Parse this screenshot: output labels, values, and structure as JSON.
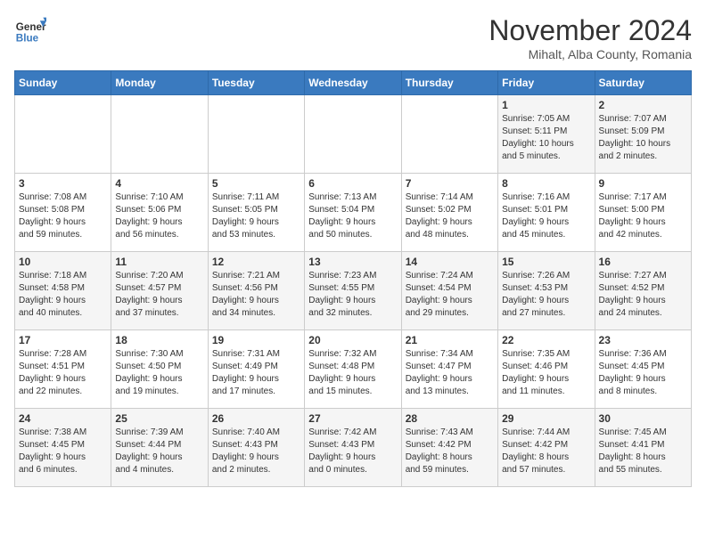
{
  "logo": {
    "general": "General",
    "blue": "Blue"
  },
  "header": {
    "month": "November 2024",
    "location": "Mihalt, Alba County, Romania"
  },
  "weekdays": [
    "Sunday",
    "Monday",
    "Tuesday",
    "Wednesday",
    "Thursday",
    "Friday",
    "Saturday"
  ],
  "weeks": [
    [
      {
        "day": "",
        "info": ""
      },
      {
        "day": "",
        "info": ""
      },
      {
        "day": "",
        "info": ""
      },
      {
        "day": "",
        "info": ""
      },
      {
        "day": "",
        "info": ""
      },
      {
        "day": "1",
        "info": "Sunrise: 7:05 AM\nSunset: 5:11 PM\nDaylight: 10 hours\nand 5 minutes."
      },
      {
        "day": "2",
        "info": "Sunrise: 7:07 AM\nSunset: 5:09 PM\nDaylight: 10 hours\nand 2 minutes."
      }
    ],
    [
      {
        "day": "3",
        "info": "Sunrise: 7:08 AM\nSunset: 5:08 PM\nDaylight: 9 hours\nand 59 minutes."
      },
      {
        "day": "4",
        "info": "Sunrise: 7:10 AM\nSunset: 5:06 PM\nDaylight: 9 hours\nand 56 minutes."
      },
      {
        "day": "5",
        "info": "Sunrise: 7:11 AM\nSunset: 5:05 PM\nDaylight: 9 hours\nand 53 minutes."
      },
      {
        "day": "6",
        "info": "Sunrise: 7:13 AM\nSunset: 5:04 PM\nDaylight: 9 hours\nand 50 minutes."
      },
      {
        "day": "7",
        "info": "Sunrise: 7:14 AM\nSunset: 5:02 PM\nDaylight: 9 hours\nand 48 minutes."
      },
      {
        "day": "8",
        "info": "Sunrise: 7:16 AM\nSunset: 5:01 PM\nDaylight: 9 hours\nand 45 minutes."
      },
      {
        "day": "9",
        "info": "Sunrise: 7:17 AM\nSunset: 5:00 PM\nDaylight: 9 hours\nand 42 minutes."
      }
    ],
    [
      {
        "day": "10",
        "info": "Sunrise: 7:18 AM\nSunset: 4:58 PM\nDaylight: 9 hours\nand 40 minutes."
      },
      {
        "day": "11",
        "info": "Sunrise: 7:20 AM\nSunset: 4:57 PM\nDaylight: 9 hours\nand 37 minutes."
      },
      {
        "day": "12",
        "info": "Sunrise: 7:21 AM\nSunset: 4:56 PM\nDaylight: 9 hours\nand 34 minutes."
      },
      {
        "day": "13",
        "info": "Sunrise: 7:23 AM\nSunset: 4:55 PM\nDaylight: 9 hours\nand 32 minutes."
      },
      {
        "day": "14",
        "info": "Sunrise: 7:24 AM\nSunset: 4:54 PM\nDaylight: 9 hours\nand 29 minutes."
      },
      {
        "day": "15",
        "info": "Sunrise: 7:26 AM\nSunset: 4:53 PM\nDaylight: 9 hours\nand 27 minutes."
      },
      {
        "day": "16",
        "info": "Sunrise: 7:27 AM\nSunset: 4:52 PM\nDaylight: 9 hours\nand 24 minutes."
      }
    ],
    [
      {
        "day": "17",
        "info": "Sunrise: 7:28 AM\nSunset: 4:51 PM\nDaylight: 9 hours\nand 22 minutes."
      },
      {
        "day": "18",
        "info": "Sunrise: 7:30 AM\nSunset: 4:50 PM\nDaylight: 9 hours\nand 19 minutes."
      },
      {
        "day": "19",
        "info": "Sunrise: 7:31 AM\nSunset: 4:49 PM\nDaylight: 9 hours\nand 17 minutes."
      },
      {
        "day": "20",
        "info": "Sunrise: 7:32 AM\nSunset: 4:48 PM\nDaylight: 9 hours\nand 15 minutes."
      },
      {
        "day": "21",
        "info": "Sunrise: 7:34 AM\nSunset: 4:47 PM\nDaylight: 9 hours\nand 13 minutes."
      },
      {
        "day": "22",
        "info": "Sunrise: 7:35 AM\nSunset: 4:46 PM\nDaylight: 9 hours\nand 11 minutes."
      },
      {
        "day": "23",
        "info": "Sunrise: 7:36 AM\nSunset: 4:45 PM\nDaylight: 9 hours\nand 8 minutes."
      }
    ],
    [
      {
        "day": "24",
        "info": "Sunrise: 7:38 AM\nSunset: 4:45 PM\nDaylight: 9 hours\nand 6 minutes."
      },
      {
        "day": "25",
        "info": "Sunrise: 7:39 AM\nSunset: 4:44 PM\nDaylight: 9 hours\nand 4 minutes."
      },
      {
        "day": "26",
        "info": "Sunrise: 7:40 AM\nSunset: 4:43 PM\nDaylight: 9 hours\nand 2 minutes."
      },
      {
        "day": "27",
        "info": "Sunrise: 7:42 AM\nSunset: 4:43 PM\nDaylight: 9 hours\nand 0 minutes."
      },
      {
        "day": "28",
        "info": "Sunrise: 7:43 AM\nSunset: 4:42 PM\nDaylight: 8 hours\nand 59 minutes."
      },
      {
        "day": "29",
        "info": "Sunrise: 7:44 AM\nSunset: 4:42 PM\nDaylight: 8 hours\nand 57 minutes."
      },
      {
        "day": "30",
        "info": "Sunrise: 7:45 AM\nSunset: 4:41 PM\nDaylight: 8 hours\nand 55 minutes."
      }
    ]
  ]
}
